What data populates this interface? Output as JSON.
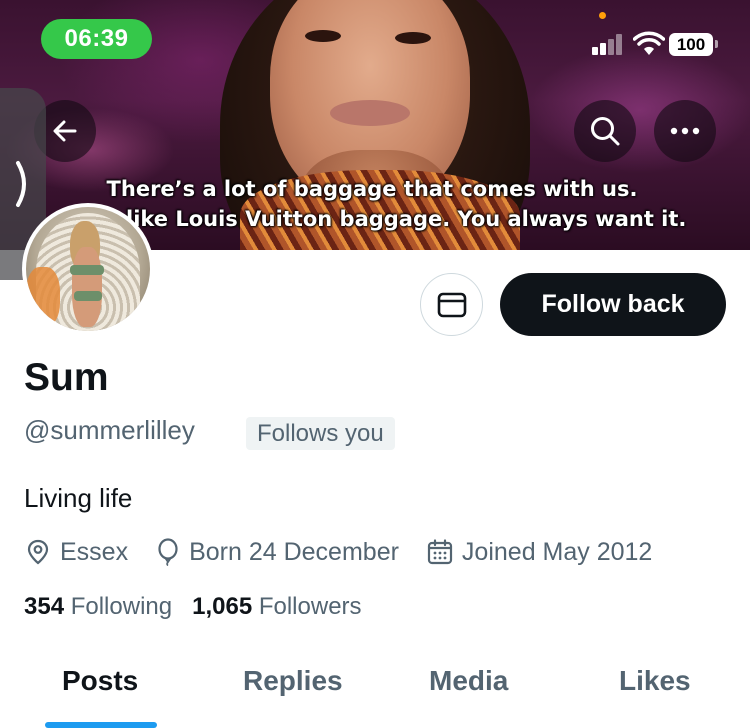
{
  "status_bar": {
    "time": "06:39",
    "battery": "100"
  },
  "banner": {
    "subtitle_line1": "There’s a lot of baggage that comes with us.",
    "subtitle_line2": "like Louis Vuitton baggage. You always want it."
  },
  "profile": {
    "display_name": "Sum",
    "handle": "@summerlilley",
    "follows_you_badge": "Follows you",
    "bio": "Living life",
    "location": "Essex",
    "birthday": "Born 24 December",
    "joined": "Joined May 2012",
    "following_count": "354",
    "following_label": "Following",
    "followers_count": "1,065",
    "followers_label": "Followers"
  },
  "actions": {
    "follow_back_label": "Follow back"
  },
  "tabs": [
    {
      "label": "Posts",
      "active": true
    },
    {
      "label": "Replies",
      "active": false
    },
    {
      "label": "Media",
      "active": false
    },
    {
      "label": "Likes",
      "active": false
    }
  ],
  "icons": {
    "back": "arrow-left-icon",
    "search": "search-icon",
    "more": "more-horizontal-icon",
    "message": "envelope-icon",
    "location": "location-pin-icon",
    "birthday": "balloon-icon",
    "joined": "calendar-icon",
    "drawer": "chevron-right-icon"
  },
  "colors": {
    "accent": "#1d9bf0",
    "time_pill": "#35c84a",
    "primary_text": "#0f1419",
    "secondary_text": "#536471"
  }
}
